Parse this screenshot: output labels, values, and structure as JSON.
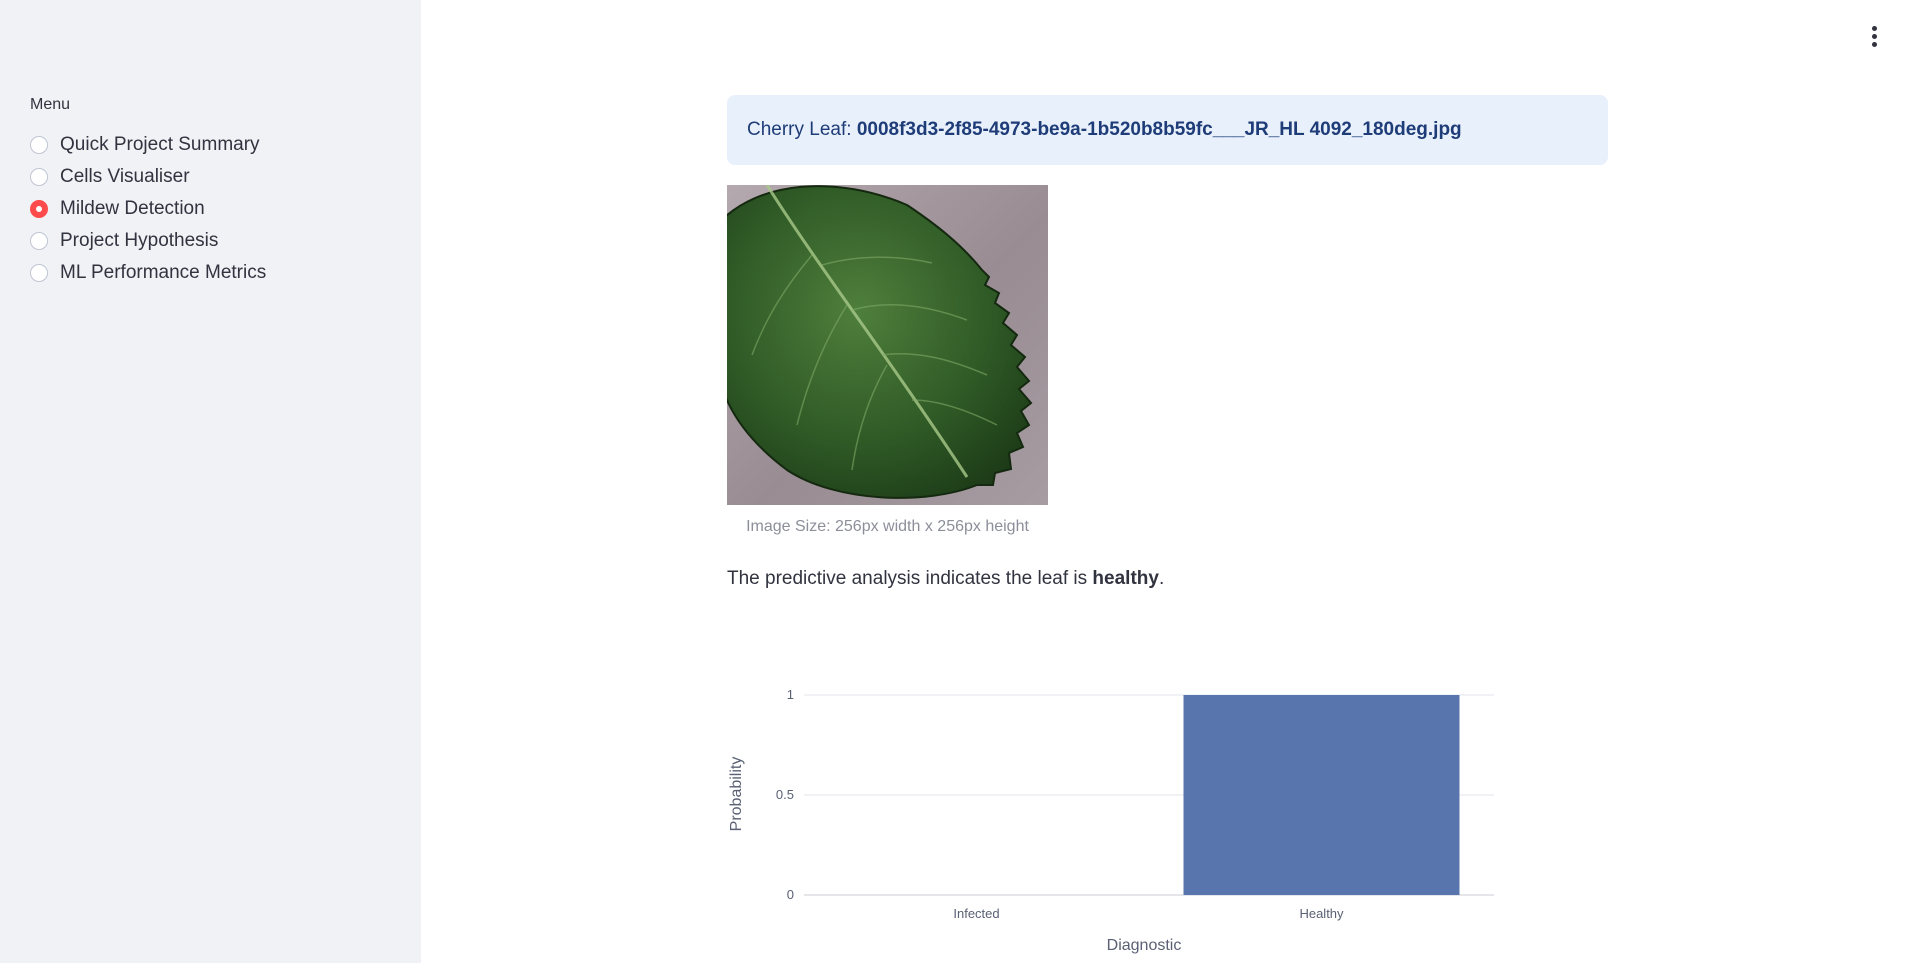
{
  "sidebar": {
    "menu_title": "Menu",
    "items": [
      {
        "label": "Quick Project Summary",
        "selected": false
      },
      {
        "label": "Cells Visualiser",
        "selected": false
      },
      {
        "label": "Mildew Detection",
        "selected": true
      },
      {
        "label": "Project Hypothesis",
        "selected": false
      },
      {
        "label": "ML Performance Metrics",
        "selected": false
      }
    ]
  },
  "header": {
    "menu_icon": "kebab-menu-icon"
  },
  "main": {
    "info": {
      "prefix": "Cherry Leaf: ",
      "filename": "0008f3d3-2f85-4973-be9a-1b520b8b59fc___JR_HL 4092_180deg.jpg"
    },
    "image_caption": "Image Size: 256px width x 256px height",
    "result": {
      "prefix": "The predictive analysis indicates the leaf is ",
      "value": "healthy",
      "suffix": "."
    }
  },
  "colors": {
    "accent": "#ff4b4b",
    "sidebar_bg": "#f0f2f6",
    "info_bg": "#e8f0fb",
    "info_text": "#1e3c78",
    "bar": "#5875ae"
  },
  "chart_data": {
    "type": "bar",
    "categories": [
      "Infected",
      "Healthy"
    ],
    "values": [
      0,
      1
    ],
    "title": "",
    "xlabel": "Diagnostic",
    "ylabel": "Probability",
    "ylim": [
      0,
      1
    ],
    "yticks": [
      "0",
      "0.5",
      "1"
    ],
    "grid": true,
    "legend": false
  }
}
